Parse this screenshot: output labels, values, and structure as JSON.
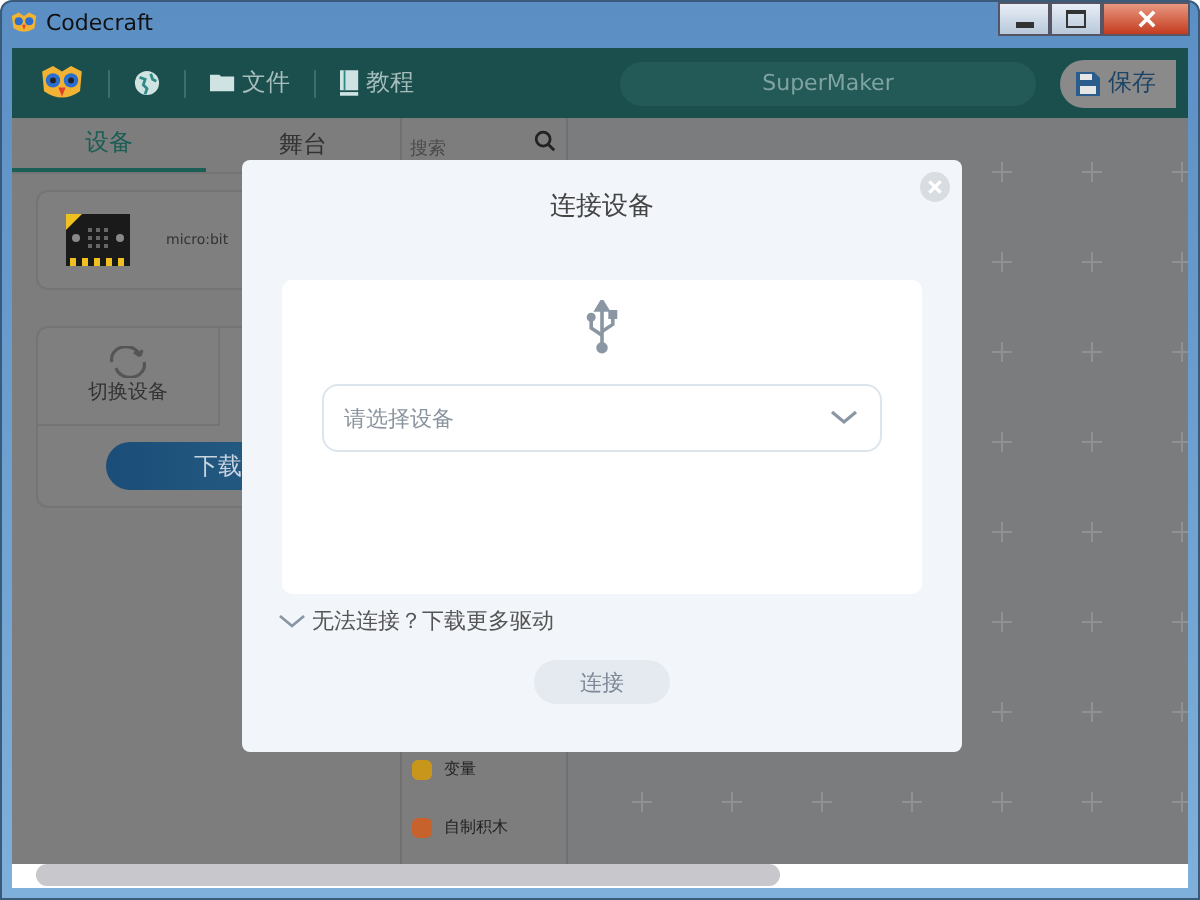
{
  "window": {
    "title": "Codecraft"
  },
  "toolbar": {
    "menus": [
      {
        "kind": "globe"
      },
      {
        "kind": "folder",
        "label": "文件"
      },
      {
        "kind": "book",
        "label": "教程"
      }
    ],
    "project_name": "SuperMaker",
    "save_button": "保存"
  },
  "sidebar": {
    "tabs": [
      {
        "label": "设备",
        "selected": true
      },
      {
        "label": "舞台",
        "selected": false
      }
    ],
    "device": {
      "name": "micro:bit"
    },
    "switch_device": "切换设备",
    "download_button": "下载"
  },
  "categories": {
    "search": {
      "placeholder": "搜索"
    },
    "items": [
      {
        "label": "变量",
        "color": "#c9961c"
      },
      {
        "label": "自制积木",
        "color": "#c8622c"
      }
    ]
  },
  "dialog": {
    "title": "连接设备",
    "select": {
      "placeholder": "请选择设备"
    },
    "help_link": "无法连接？下载更多驱动",
    "connect_button": "连接",
    "connect_disabled": true
  }
}
